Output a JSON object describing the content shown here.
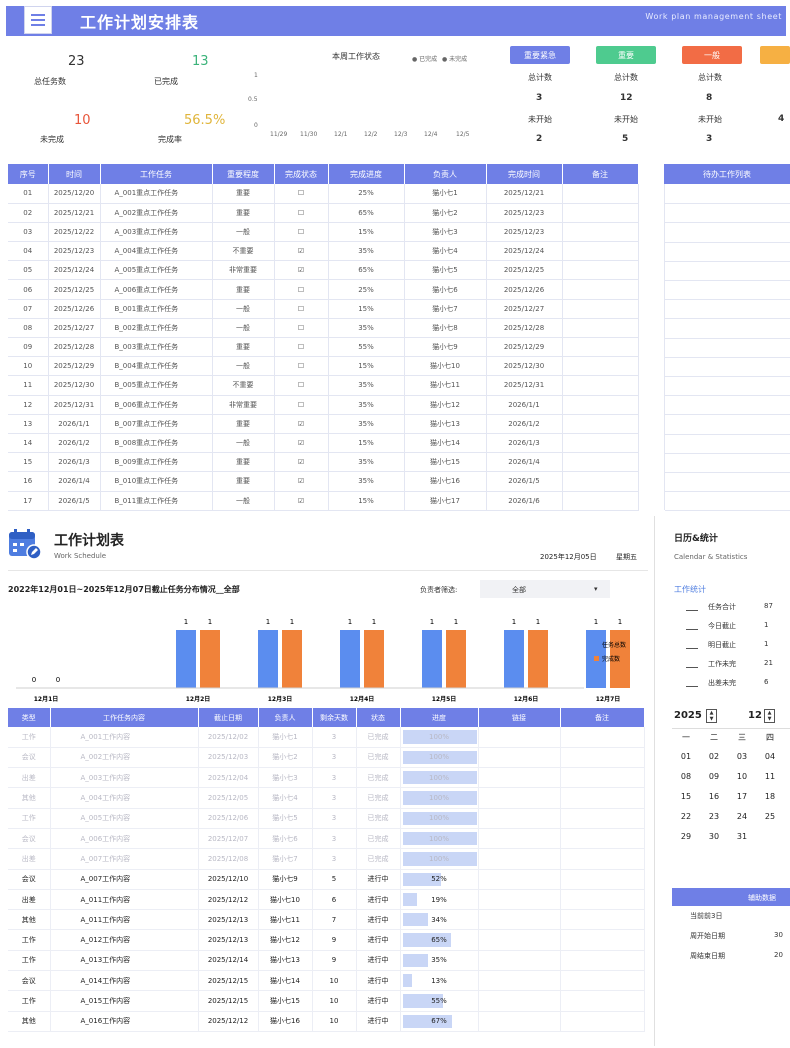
{
  "header": {
    "title": "工作计划安排表",
    "subtitle": "Work plan management sheet"
  },
  "kpis": [
    {
      "label": "总任务数",
      "value": "23",
      "icon": "clipboard-icon",
      "color": "#4e5fcf"
    },
    {
      "label": "已完成",
      "value": "13",
      "icon": "check-icon",
      "color": "#3bb37a"
    },
    {
      "label": "未完成",
      "value": "10",
      "icon": "cross-icon",
      "color": "#e8553a"
    },
    {
      "label": "完成率",
      "value": "56.5%",
      "icon": "clock-icon",
      "color": "#f0b130"
    }
  ],
  "mini_chart": {
    "title": "本周工作状态",
    "legend": [
      "已完成",
      "未完成"
    ],
    "yticks": [
      "1",
      "0.5",
      "0"
    ],
    "xticks": [
      "11/29",
      "11/30",
      "12/1",
      "12/2",
      "12/3",
      "12/4",
      "12/5"
    ]
  },
  "stat_cards": [
    {
      "button": "重要紧急",
      "color": "#6f7fe6",
      "total_label": "总计数",
      "total": "3",
      "open_label": "未开始",
      "open": "2"
    },
    {
      "button": "重要",
      "color": "#4ecb8f",
      "total_label": "总计数",
      "total": "12",
      "open_label": "未开始",
      "open": "5"
    },
    {
      "button": "一般",
      "color": "#f26c45",
      "total_label": "总计数",
      "total": "8",
      "open_label": "未开始",
      "open": "3"
    },
    {
      "button": "",
      "color": "#f6b043",
      "total_label": "",
      "total": "",
      "open_label": "",
      "open": "4"
    }
  ],
  "task_table": {
    "columns": [
      "序号",
      "时间",
      "工作任务",
      "重要程度",
      "完成状态",
      "完成进度",
      "负责人",
      "完成时间",
      "备注"
    ],
    "rows": [
      [
        "01",
        "2025/12/20",
        "A_001重点工作任务",
        "重要",
        "☐",
        "25%",
        "猫小七1",
        "2025/12/21",
        ""
      ],
      [
        "02",
        "2025/12/21",
        "A_002重点工作任务",
        "重要",
        "☐",
        "65%",
        "猫小七2",
        "2025/12/23",
        ""
      ],
      [
        "03",
        "2025/12/22",
        "A_003重点工作任务",
        "一般",
        "☐",
        "15%",
        "猫小七3",
        "2025/12/23",
        ""
      ],
      [
        "04",
        "2025/12/23",
        "A_004重点工作任务",
        "不重要",
        "☑",
        "35%",
        "猫小七4",
        "2025/12/24",
        ""
      ],
      [
        "05",
        "2025/12/24",
        "A_005重点工作任务",
        "非常重要",
        "☑",
        "65%",
        "猫小七5",
        "2025/12/25",
        ""
      ],
      [
        "06",
        "2025/12/25",
        "A_006重点工作任务",
        "重要",
        "☐",
        "25%",
        "猫小七6",
        "2025/12/26",
        ""
      ],
      [
        "07",
        "2025/12/26",
        "B_001重点工作任务",
        "一般",
        "☐",
        "15%",
        "猫小七7",
        "2025/12/27",
        ""
      ],
      [
        "08",
        "2025/12/27",
        "B_002重点工作任务",
        "一般",
        "☐",
        "35%",
        "猫小七8",
        "2025/12/28",
        ""
      ],
      [
        "09",
        "2025/12/28",
        "B_003重点工作任务",
        "重要",
        "☐",
        "55%",
        "猫小七9",
        "2025/12/29",
        ""
      ],
      [
        "10",
        "2025/12/29",
        "B_004重点工作任务",
        "一般",
        "☐",
        "15%",
        "猫小七10",
        "2025/12/30",
        ""
      ],
      [
        "11",
        "2025/12/30",
        "B_005重点工作任务",
        "不重要",
        "☐",
        "35%",
        "猫小七11",
        "2025/12/31",
        ""
      ],
      [
        "12",
        "2025/12/31",
        "B_006重点工作任务",
        "非常重要",
        "☐",
        "35%",
        "猫小七12",
        "2026/1/1",
        ""
      ],
      [
        "13",
        "2026/1/1",
        "B_007重点工作任务",
        "重要",
        "☑",
        "35%",
        "猫小七13",
        "2026/1/2",
        ""
      ],
      [
        "14",
        "2026/1/2",
        "B_008重点工作任务",
        "一般",
        "☑",
        "15%",
        "猫小七14",
        "2026/1/3",
        ""
      ],
      [
        "15",
        "2026/1/3",
        "B_009重点工作任务",
        "重要",
        "☑",
        "35%",
        "猫小七15",
        "2026/1/4",
        ""
      ],
      [
        "16",
        "2026/1/4",
        "B_010重点工作任务",
        "重要",
        "☑",
        "35%",
        "猫小七16",
        "2026/1/5",
        ""
      ],
      [
        "17",
        "2026/1/5",
        "B_011重点工作任务",
        "一般",
        "☑",
        "15%",
        "猫小七17",
        "2026/1/6",
        ""
      ]
    ]
  },
  "side_panel": {
    "title": "待办工作列表"
  },
  "schedule": {
    "title": "工作计划表",
    "subtitle": "Work Schedule",
    "date": "2025年12月05日",
    "weekday": "星期五",
    "range": "2022年12月01日~2025年12月07日截止任务分布情况__全部",
    "filter_label": "负责者筛选:",
    "filter_value": "全部",
    "filter_arrow": "▾"
  },
  "chart_data": {
    "type": "bar",
    "categories": [
      "12月1日",
      "12月2日",
      "12月3日",
      "12月4日",
      "12月5日",
      "12月6日",
      "12月7日"
    ],
    "series": [
      {
        "name": "任务总数",
        "values": [
          0,
          1,
          1,
          1,
          1,
          1,
          1
        ],
        "color": "#5b8def"
      },
      {
        "name": "完成数",
        "values": [
          0,
          1,
          1,
          1,
          1,
          1,
          1
        ],
        "color": "#f0823a"
      }
    ],
    "ylim": [
      0,
      1
    ],
    "legend_position": "right"
  },
  "schedule_table": {
    "columns": [
      "类型",
      "工作任务内容",
      "截止日期",
      "负责人",
      "剩余天数",
      "状态",
      "进度",
      "链接",
      "备注"
    ],
    "rows": [
      {
        "cells": [
          "工作",
          "A_001工作内容",
          "2025/12/02",
          "猫小七1",
          "3",
          "已完成",
          "100%",
          "",
          ""
        ],
        "done": true,
        "pct": 100
      },
      {
        "cells": [
          "会议",
          "A_002工作内容",
          "2025/12/03",
          "猫小七2",
          "3",
          "已完成",
          "100%",
          "",
          ""
        ],
        "done": true,
        "pct": 100
      },
      {
        "cells": [
          "出差",
          "A_003工作内容",
          "2025/12/04",
          "猫小七3",
          "3",
          "已完成",
          "100%",
          "",
          ""
        ],
        "done": true,
        "pct": 100
      },
      {
        "cells": [
          "其他",
          "A_004工作内容",
          "2025/12/05",
          "猫小七4",
          "3",
          "已完成",
          "100%",
          "",
          ""
        ],
        "done": true,
        "pct": 100
      },
      {
        "cells": [
          "工作",
          "A_005工作内容",
          "2025/12/06",
          "猫小七5",
          "3",
          "已完成",
          "100%",
          "",
          ""
        ],
        "done": true,
        "pct": 100
      },
      {
        "cells": [
          "会议",
          "A_006工作内容",
          "2025/12/07",
          "猫小七6",
          "3",
          "已完成",
          "100%",
          "",
          ""
        ],
        "done": true,
        "pct": 100
      },
      {
        "cells": [
          "出差",
          "A_007工作内容",
          "2025/12/08",
          "猫小七7",
          "3",
          "已完成",
          "100%",
          "",
          ""
        ],
        "done": true,
        "pct": 100
      },
      {
        "cells": [
          "会议",
          "A_007工作内容",
          "2025/12/10",
          "猫小七9",
          "5",
          "进行中",
          "52%",
          "",
          ""
        ],
        "done": false,
        "pct": 52
      },
      {
        "cells": [
          "出差",
          "A_011工作内容",
          "2025/12/12",
          "猫小七10",
          "6",
          "进行中",
          "19%",
          "",
          ""
        ],
        "done": false,
        "pct": 19
      },
      {
        "cells": [
          "其他",
          "A_011工作内容",
          "2025/12/13",
          "猫小七11",
          "7",
          "进行中",
          "34%",
          "",
          ""
        ],
        "done": false,
        "pct": 34
      },
      {
        "cells": [
          "工作",
          "A_012工作内容",
          "2025/12/13",
          "猫小七12",
          "9",
          "进行中",
          "65%",
          "",
          ""
        ],
        "done": false,
        "pct": 65
      },
      {
        "cells": [
          "工作",
          "A_013工作内容",
          "2025/12/14",
          "猫小七13",
          "9",
          "进行中",
          "35%",
          "",
          ""
        ],
        "done": false,
        "pct": 35
      },
      {
        "cells": [
          "会议",
          "A_014工作内容",
          "2025/12/15",
          "猫小七14",
          "10",
          "进行中",
          "13%",
          "",
          ""
        ],
        "done": false,
        "pct": 13
      },
      {
        "cells": [
          "工作",
          "A_015工作内容",
          "2025/12/15",
          "猫小七15",
          "10",
          "进行中",
          "55%",
          "",
          ""
        ],
        "done": false,
        "pct": 55
      },
      {
        "cells": [
          "其他",
          "A_016工作内容",
          "2025/12/12",
          "猫小七16",
          "10",
          "进行中",
          "67%",
          "",
          ""
        ],
        "done": false,
        "pct": 67
      }
    ]
  },
  "calendar": {
    "title": "日历&统计",
    "subtitle": "Calendar & Statistics",
    "stats_title": "工作统计",
    "stats": [
      {
        "label": "任务合计",
        "value": "87"
      },
      {
        "label": "今日截止",
        "value": "1"
      },
      {
        "label": "明日截止",
        "value": "1"
      },
      {
        "label": "工作未完",
        "value": "21"
      },
      {
        "label": "出差未完",
        "value": "6"
      }
    ],
    "year": "2025",
    "month": "12",
    "weekdays": [
      "一",
      "二",
      "三",
      "四"
    ],
    "days": [
      [
        "01",
        "02",
        "03",
        "04"
      ],
      [
        "08",
        "09",
        "10",
        "11"
      ],
      [
        "15",
        "16",
        "17",
        "18"
      ],
      [
        "22",
        "23",
        "24",
        "25"
      ],
      [
        "29",
        "30",
        "31",
        ""
      ]
    ],
    "aux_title": "辅助数据",
    "aux": [
      {
        "label": "当前前3日",
        "value": ""
      },
      {
        "label": "周开始日期",
        "value": "30"
      },
      {
        "label": "周结束日期",
        "value": "20"
      }
    ]
  }
}
